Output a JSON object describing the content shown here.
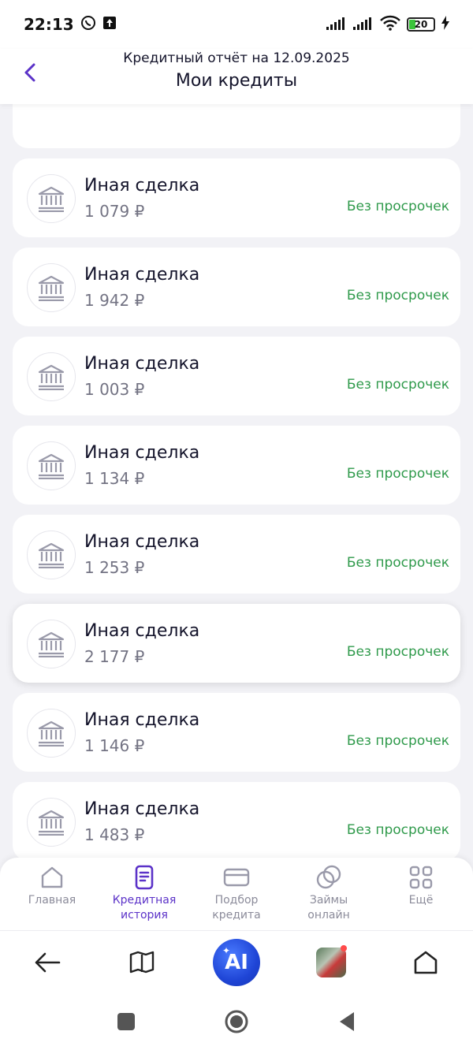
{
  "status_bar": {
    "time": "22:13",
    "battery": "20"
  },
  "header": {
    "subtitle": "Кредитный отчёт на 12.09.2025",
    "title": "Мои кредиты"
  },
  "loans": [
    {
      "title": "Иная сделка",
      "amount": "1 079 ₽",
      "status": "Без просрочек"
    },
    {
      "title": "Иная сделка",
      "amount": "1 942 ₽",
      "status": "Без просрочек"
    },
    {
      "title": "Иная сделка",
      "amount": "1 003 ₽",
      "status": "Без просрочек"
    },
    {
      "title": "Иная сделка",
      "amount": "1 134 ₽",
      "status": "Без просрочек"
    },
    {
      "title": "Иная сделка",
      "amount": "1 253 ₽",
      "status": "Без просрочек"
    },
    {
      "title": "Иная сделка",
      "amount": "2 177 ₽",
      "status": "Без просрочек"
    },
    {
      "title": "Иная сделка",
      "amount": "1 146 ₽",
      "status": "Без просрочек"
    },
    {
      "title": "Иная сделка",
      "amount": "1 483 ₽",
      "status": "Без просрочек"
    }
  ],
  "tabs": [
    {
      "label": "Главная",
      "icon": "home-icon",
      "active": false
    },
    {
      "label": "Кредитная\nистория",
      "icon": "document-icon",
      "active": true
    },
    {
      "label": "Подбор\nкредита",
      "icon": "card-icon",
      "active": false
    },
    {
      "label": "Займы\nонлайн",
      "icon": "circles-icon",
      "active": false
    },
    {
      "label": "Ещё",
      "icon": "grid-icon",
      "active": false
    }
  ],
  "browser_bar": {
    "ai_label": "AI"
  },
  "colors": {
    "accent": "#5b32c8",
    "status_ok": "#2f9a4b",
    "background": "#f2f2f6"
  }
}
